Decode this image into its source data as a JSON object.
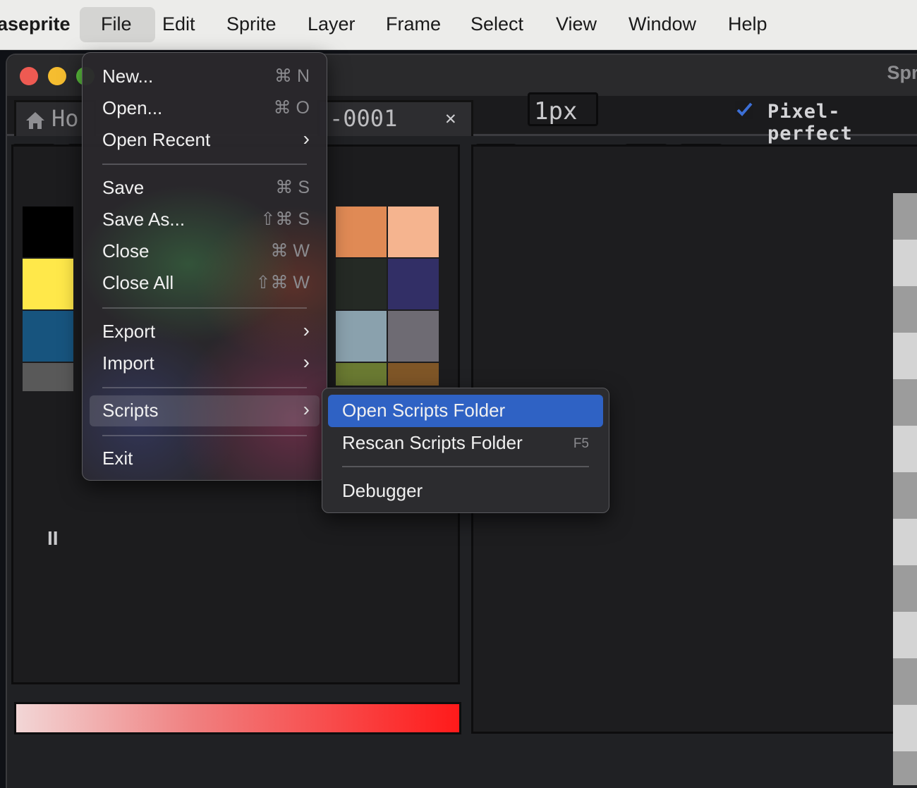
{
  "menubar": {
    "app_name": "aseprite",
    "items": [
      "File",
      "Edit",
      "Sprite",
      "Layer",
      "Frame",
      "Select",
      "View",
      "Window",
      "Help"
    ]
  },
  "window": {
    "title": "Spri",
    "tabs": [
      {
        "label": "Ho",
        "icon": "home-icon"
      },
      {
        "label": "-0001",
        "close": "✕"
      }
    ]
  },
  "toolbar": {
    "brush_size": "1px",
    "pixel_perfect_label": "Pixel-perfect",
    "pixel_perfect_checked": true
  },
  "palette": {
    "swatches": [
      "#000000",
      "#e08a55",
      "#f5b48f",
      "#ffe84a",
      "#252a25",
      "#322f66",
      "#17547e",
      "#8aa1ad",
      "#6e6b73",
      "#595959",
      "#6a7a32",
      "#7f5627"
    ],
    "play_label": "II"
  },
  "file_menu": {
    "items": [
      {
        "label": "New...",
        "shortcut": "⌘ N"
      },
      {
        "label": "Open...",
        "shortcut": "⌘ O"
      },
      {
        "label": "Open Recent",
        "submenu": true
      },
      {
        "label": "Save",
        "shortcut": "⌘ S"
      },
      {
        "label": "Save As...",
        "shortcut": "⇧⌘ S"
      },
      {
        "label": "Close",
        "shortcut": "⌘ W"
      },
      {
        "label": "Close All",
        "shortcut": "⇧⌘ W"
      },
      {
        "label": "Export",
        "submenu": true
      },
      {
        "label": "Import",
        "submenu": true
      },
      {
        "label": "Scripts",
        "submenu": true
      },
      {
        "label": "Exit"
      }
    ],
    "submenu_arrow": "›"
  },
  "scripts_submenu": {
    "items": [
      {
        "label": "Open Scripts Folder",
        "shortcut": ""
      },
      {
        "label": "Rescan Scripts Folder",
        "shortcut": "F5"
      },
      {
        "label": "Debugger",
        "shortcut": ""
      }
    ]
  },
  "colors": {
    "highlight": "#2f62c4",
    "traffic_close": "#ee5a52",
    "traffic_min": "#f5bd30",
    "traffic_max": "#5fc93f"
  }
}
